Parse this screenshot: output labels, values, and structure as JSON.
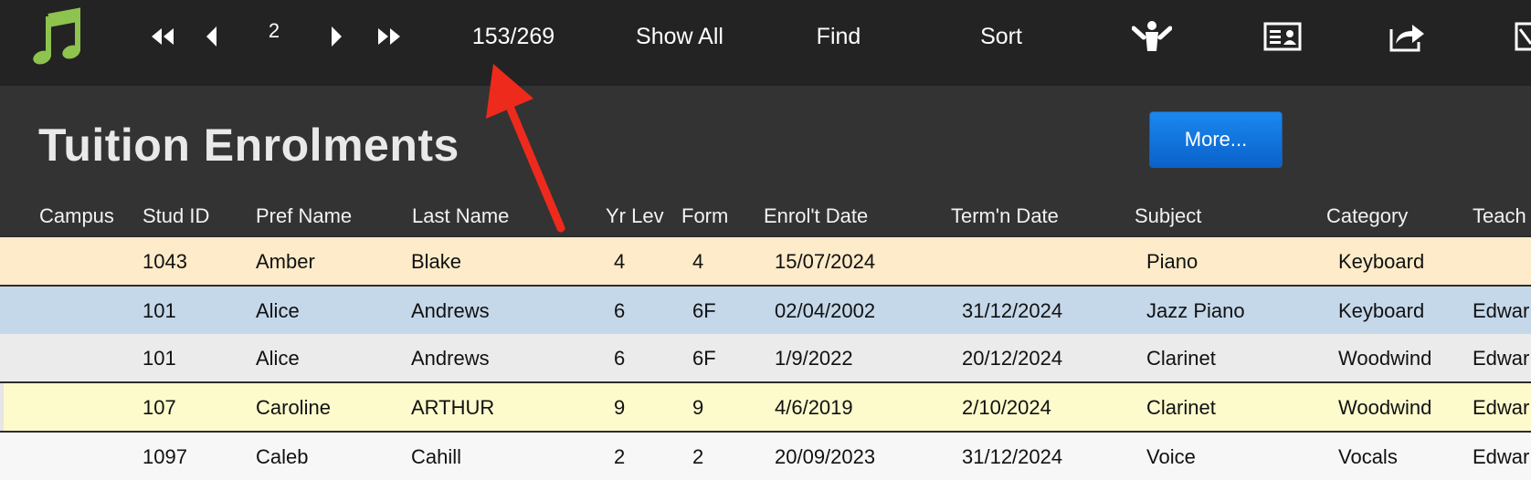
{
  "toolbar": {
    "record_number": "2",
    "record_count": "153/269",
    "show_all": "Show All",
    "find": "Find",
    "sort": "Sort"
  },
  "header": {
    "title": "Tuition Enrolments",
    "more_button": "More..."
  },
  "columns": [
    "Campus",
    "Stud ID",
    "Pref Name",
    "Last Name",
    "Yr Lev",
    "Form",
    "Enrol't Date",
    "Term'n Date",
    "Subject",
    "Category",
    "Teach"
  ],
  "rows": [
    {
      "campus": "",
      "stud_id": "1043",
      "pref_name": "Amber",
      "last_name": "Blake",
      "yr_lev": "4",
      "form": "4",
      "enrol_date": "15/07/2024",
      "term_date": "",
      "subject": "Piano",
      "category": "Keyboard",
      "teacher": ""
    },
    {
      "campus": "",
      "stud_id": "101",
      "pref_name": "Alice",
      "last_name": "Andrews",
      "yr_lev": "6",
      "form": "6F",
      "enrol_date": "02/04/2002",
      "term_date": "31/12/2024",
      "subject": "Jazz Piano",
      "category": "Keyboard",
      "teacher": "Edwar"
    },
    {
      "campus": "",
      "stud_id": "101",
      "pref_name": "Alice",
      "last_name": "Andrews",
      "yr_lev": "6",
      "form": "6F",
      "enrol_date": "1/9/2022",
      "term_date": "20/12/2024",
      "subject": "Clarinet",
      "category": "Woodwind",
      "teacher": "Edwar"
    },
    {
      "campus": "",
      "stud_id": "107",
      "pref_name": "Caroline",
      "last_name": "ARTHUR",
      "yr_lev": "9",
      "form": "9",
      "enrol_date": "4/6/2019",
      "term_date": "2/10/2024",
      "subject": "Clarinet",
      "category": "Woodwind",
      "teacher": "Edwar"
    },
    {
      "campus": "",
      "stud_id": "1097",
      "pref_name": "Caleb",
      "last_name": "Cahill",
      "yr_lev": "2",
      "form": "2",
      "enrol_date": "20/09/2023",
      "term_date": "31/12/2024",
      "subject": "Voice",
      "category": "Vocals",
      "teacher": "Edwar"
    }
  ],
  "colors": {
    "toolbar_bg": "#232323",
    "header_bg": "#333333",
    "row_highlight_peach": "#fdebc9",
    "row_highlight_blue": "#c5d8ea",
    "row_grey": "#ebebeb",
    "row_yellow": "#fdfbcc",
    "row_white": "#f7f7f7",
    "accent_button": "#0e6fdc",
    "annotation_arrow": "#ee2a1c",
    "app_icon": "#8dc34e"
  },
  "icons": {
    "app": "music-note-icon",
    "first": "first-record-icon",
    "prev": "previous-record-icon",
    "next": "next-record-icon",
    "last": "last-record-icon",
    "person": "person-icon",
    "card": "contact-card-icon",
    "share": "share-icon"
  }
}
